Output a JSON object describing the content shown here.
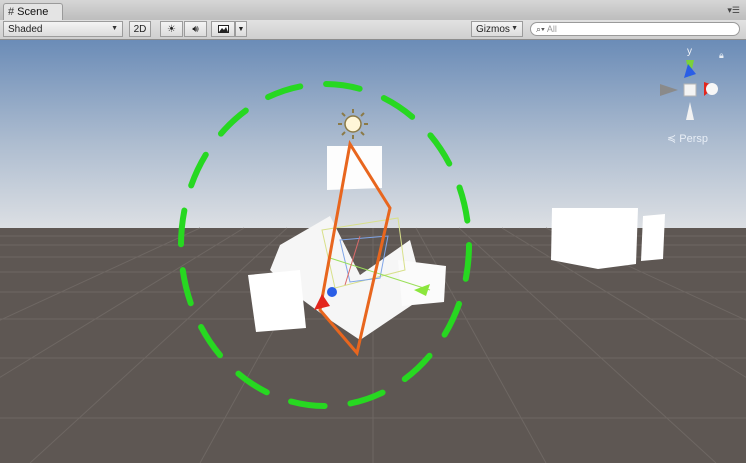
{
  "tab": {
    "title": "Scene",
    "icon": "grid-icon"
  },
  "toolbar": {
    "shading_mode": "Shaded",
    "mode_2d": "2D",
    "gizmos_label": "Gizmos",
    "search_placeholder": "All",
    "tools": [
      "light-icon",
      "audio-icon",
      "image-effects-icon"
    ]
  },
  "viewport": {
    "projection_label": "Persp",
    "axis_labels": {
      "y": "y",
      "x": "x"
    },
    "colors": {
      "sky_top": "#6e8fb8",
      "sky_horizon": "#d9dde2",
      "ground": "#5e5753",
      "light_ring": "#27d821",
      "selection_outline": "#e8661e"
    }
  }
}
